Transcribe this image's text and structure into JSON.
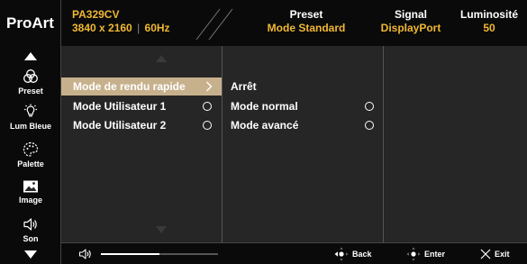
{
  "header": {
    "brand": "ProArt",
    "model": "PA329CV",
    "resolution": "3840 x 2160",
    "refresh": "60Hz",
    "preset_label": "Preset",
    "preset_value": "Mode Standard",
    "signal_label": "Signal",
    "signal_value": "DisplayPort",
    "lum_label": "Luminosité",
    "lum_value": "50"
  },
  "sidebar": {
    "items": [
      {
        "label": "Preset",
        "icon": "preset-icon"
      },
      {
        "label": "Lum Bleue",
        "icon": "blue-light-icon"
      },
      {
        "label": "Palette",
        "icon": "palette-icon"
      },
      {
        "label": "Image",
        "icon": "image-icon"
      },
      {
        "label": "Son",
        "icon": "speaker-icon"
      }
    ]
  },
  "menu1": {
    "items": [
      {
        "label": "Mode de rendu rapide",
        "state": "selected"
      },
      {
        "label": "Mode Utilisateur 1",
        "state": "radio"
      },
      {
        "label": "Mode Utilisateur 2",
        "state": "radio"
      }
    ]
  },
  "menu2": {
    "items": [
      {
        "label": "Arrêt"
      },
      {
        "label": "Mode normal"
      },
      {
        "label": "Mode avancé"
      }
    ]
  },
  "footer": {
    "volume_level": 0.5,
    "back_label": "Back",
    "enter_label": "Enter",
    "exit_label": "Exit"
  },
  "colors": {
    "accent": "#f0b833",
    "selection": "#c7b18c",
    "panel": "#262626",
    "background": "#0a0a0a"
  }
}
